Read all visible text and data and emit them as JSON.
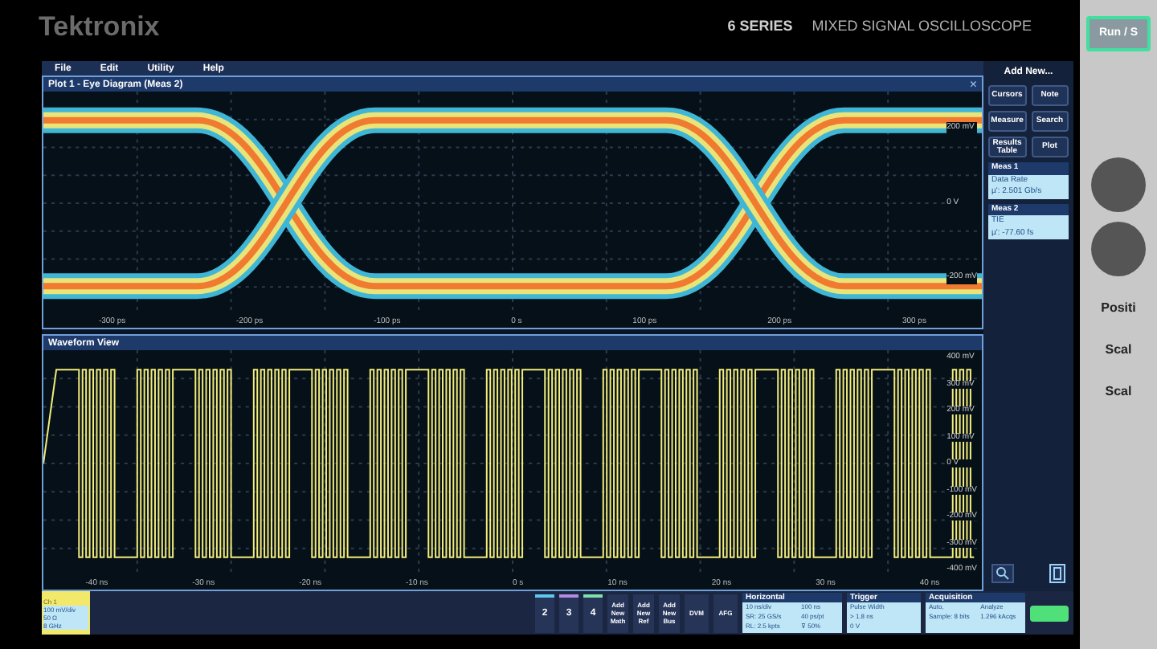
{
  "header": {
    "brand": "Tektronix",
    "series": "6 SERIES",
    "product": "MIXED SIGNAL OSCILLOSCOPE"
  },
  "menu": [
    "File",
    "Edit",
    "Utility",
    "Help"
  ],
  "eye_plot": {
    "title": "Plot 1 - Eye Diagram (Meas 2)",
    "close": "×",
    "y_labels": [
      "200 mV",
      "0 V",
      "-200 mV"
    ],
    "x_labels": [
      "-300 ps",
      "-200 ps",
      "-100 ps",
      "0 s",
      "100 ps",
      "200 ps",
      "300 ps"
    ]
  },
  "waveform_view": {
    "title": "Waveform View",
    "y_labels": [
      "400 mV",
      "300 mV",
      "200 mV",
      "100 mV",
      "0 V",
      "-100 mV",
      "-200 mV",
      "-300 mV",
      "-400 mV"
    ],
    "x_labels": [
      "-40 ns",
      "-30 ns",
      "-20 ns",
      "-10 ns",
      "0 s",
      "10 ns",
      "20 ns",
      "30 ns",
      "40 ns"
    ]
  },
  "sidebar": {
    "title": "Add New...",
    "buttons": [
      "Cursors",
      "Note",
      "Measure",
      "Search",
      "Results Table",
      "Plot"
    ],
    "measurements": [
      {
        "name": "Meas 1",
        "label": "Data Rate",
        "value": "µ': 2.501 Gb/s"
      },
      {
        "name": "Meas 2",
        "label": "TIE",
        "value": "µ': -77.60 fs"
      }
    ]
  },
  "channel": {
    "name": "Ch 1",
    "color": "#f2e96a",
    "lines": [
      "100 mV/div",
      "50 Ω",
      "8 GHz"
    ]
  },
  "channel_buttons": [
    {
      "label": "2",
      "color": "#5ec8f0"
    },
    {
      "label": "3",
      "color": "#b28ce0"
    },
    {
      "label": "4",
      "color": "#7fe0b0"
    }
  ],
  "add_buttons": [
    [
      "Add",
      "New",
      "Math"
    ],
    [
      "Add",
      "New",
      "Ref"
    ],
    [
      "Add",
      "New",
      "Bus"
    ]
  ],
  "tool_buttons": [
    "DVM",
    "AFG"
  ],
  "badges": [
    {
      "title": "Horizontal",
      "cells": [
        "10 ns/div",
        "100 ns",
        "SR: 25 GS/s",
        "40 ps/pt",
        "RL: 2.5 kpts",
        "⊽ 50%"
      ]
    },
    {
      "title": "Trigger",
      "cells": [
        "Pulse Width",
        "> 1.8 ns",
        "0 V"
      ]
    },
    {
      "title": "Acquisition",
      "cells": [
        "Auto,",
        "Analyze",
        "Sample: 8 bits",
        "1.296 kAcqs"
      ]
    }
  ],
  "bezel": {
    "run_button": "Run / S",
    "labels": [
      "Positi",
      "Scal",
      "Scal"
    ]
  }
}
